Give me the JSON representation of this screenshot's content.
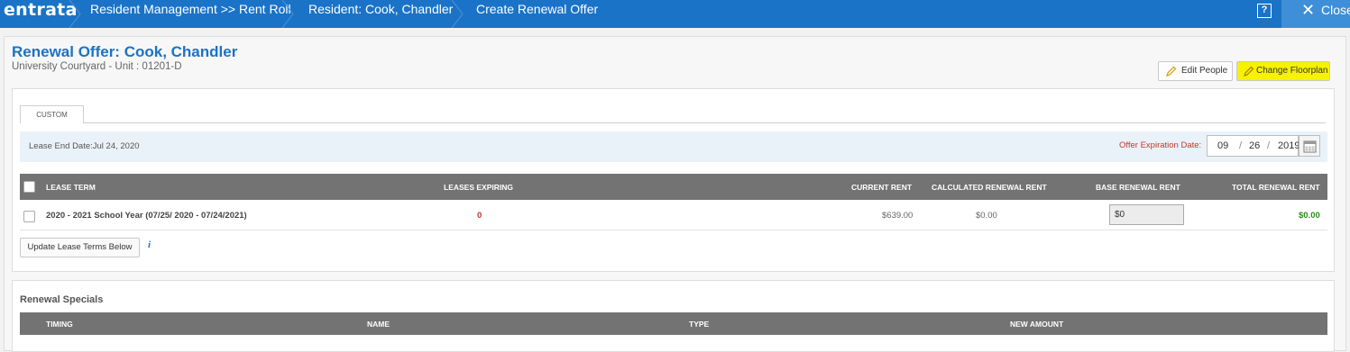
{
  "app": {
    "logo": "entrata"
  },
  "breadcrumbs": [
    "Resident Management >> Rent Roll",
    "Resident: Cook, Chandler",
    "Create Renewal Offer"
  ],
  "topbar": {
    "help_label": "?",
    "close_label": "Close"
  },
  "header": {
    "title": "Renewal Offer: Cook, Chandler",
    "subtitle": "University Courtyard  - Unit : 01201-D",
    "edit_people_label": "Edit People",
    "change_floorplan_label": "Change Floorplan"
  },
  "tabs": [
    {
      "label": "CUSTOM",
      "active": true
    }
  ],
  "info": {
    "lease_end": "Lease End Date:Jul 24, 2020",
    "offer_expiration_label": "Offer Expiration Date:",
    "offer_month": "09",
    "offer_day": "26",
    "offer_year": "2019",
    "date_sep": "/"
  },
  "lease_table": {
    "columns": [
      "LEASE TERM",
      "LEASES EXPIRING",
      "CURRENT RENT",
      "CALCULATED RENEWAL RENT",
      "BASE RENEWAL RENT",
      "TOTAL RENEWAL RENT"
    ],
    "rows": [
      {
        "term": "2020 - 2021 School Year (07/25/ 2020 - 07/24/2021)",
        "leases_expiring": "0",
        "current_rent": "$639.00",
        "calculated_renewal_rent": "$0.00",
        "base_renewal_rent": "$0",
        "total_renewal_rent": "$0.00"
      }
    ]
  },
  "update_button_label": "Update Lease Terms Below",
  "specials": {
    "title": "Renewal Specials",
    "columns": [
      "TIMING",
      "NAME",
      "TYPE",
      "NEW AMOUNT"
    ]
  },
  "colors": {
    "brand_blue": "#1a73c7",
    "header_gray": "#737373",
    "highlight_yellow": "#f6f200",
    "expiring_red": "#c0392b",
    "total_green": "#2e8b1e"
  },
  "icons": [
    "help-icon",
    "close-icon",
    "pencil-icon",
    "calendar-icon",
    "info-icon",
    "chevron-right-icon"
  ]
}
